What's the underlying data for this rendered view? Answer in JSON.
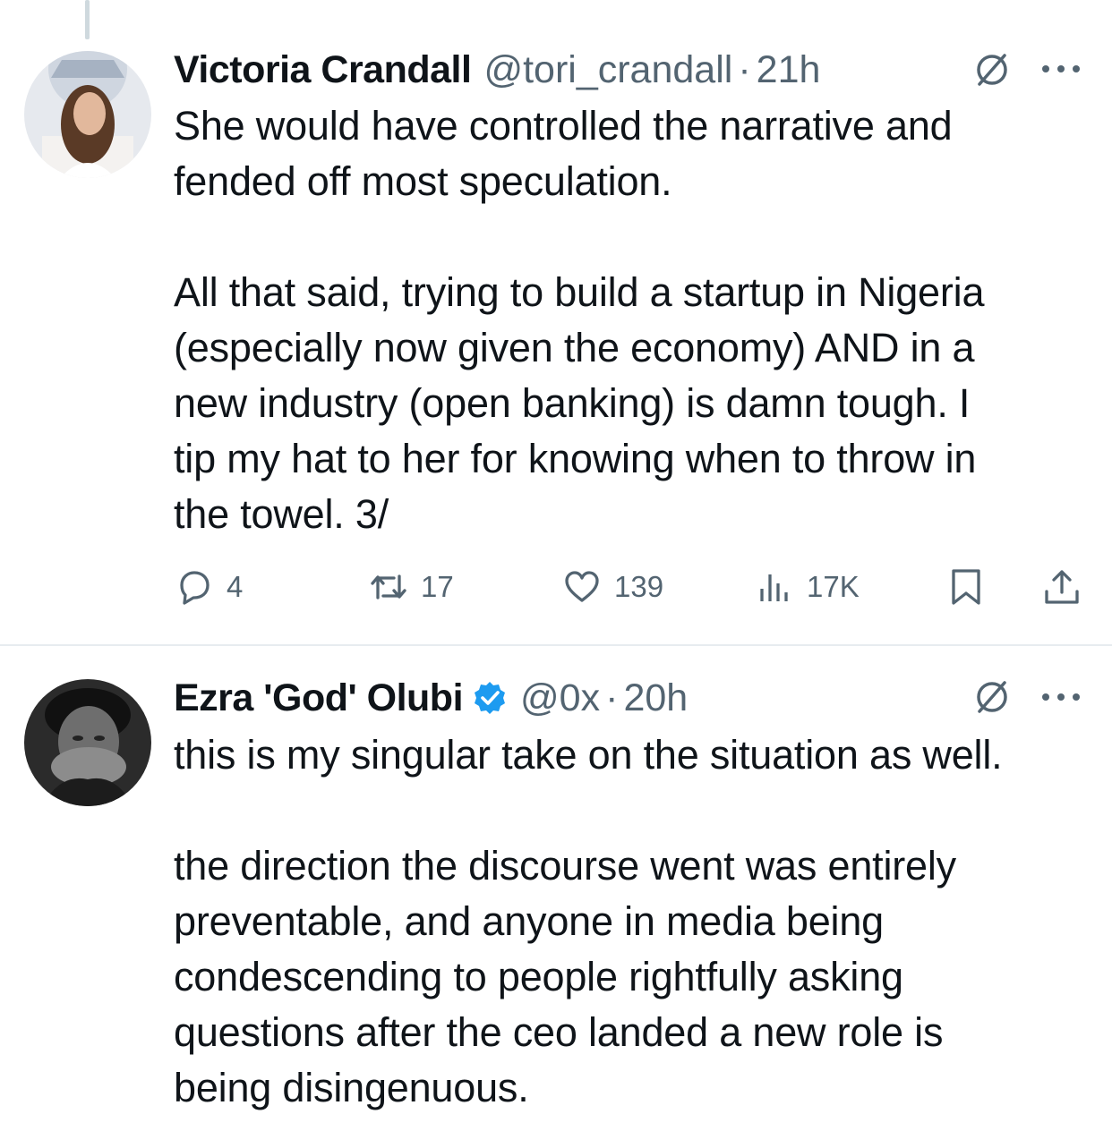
{
  "tweets": [
    {
      "display_name": "Victoria Crandall",
      "handle": "@tori_crandall",
      "separator": "·",
      "time": "21h",
      "text": "She would have controlled the narrative and\nfended off most speculation.\n\nAll that said, trying to build a startup in Nigeria\n(especially now given the economy) AND in a\nnew industry (open banking) is damn tough. I\ntip my hat to her for knowing when to throw in\nthe towel. 3/",
      "stats": {
        "replies": "4",
        "reposts": "17",
        "likes": "139",
        "views": "17K"
      }
    },
    {
      "display_name": "Ezra 'God' Olubi",
      "handle": "@0x",
      "separator": "·",
      "time": "20h",
      "verified": true,
      "text": "this is my singular take on the situation as well.\n\nthe direction the discourse went was entirely\npreventable, and anyone in media being\ncondescending to people rightfully asking\nquestions after the ceo landed a new role is\nbeing disingenuous."
    }
  ],
  "colors": {
    "text": "#0f1419",
    "muted": "#536471",
    "verified": "#1d9bf0",
    "divider": "#e7ecf0"
  },
  "icons": [
    "reply-icon",
    "repost-icon",
    "like-icon",
    "views-icon",
    "bookmark-icon",
    "share-icon",
    "grok-icon",
    "more-icon",
    "verified-icon"
  ]
}
